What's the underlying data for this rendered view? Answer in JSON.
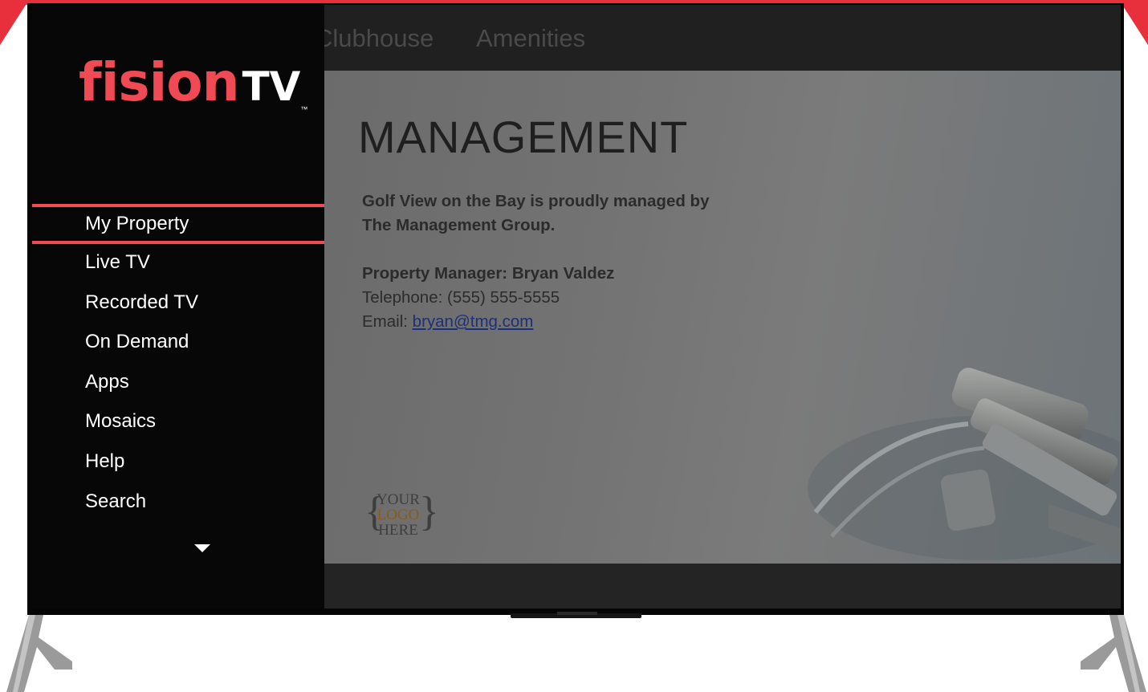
{
  "top_nav": {
    "tabs": [
      "Clubhouse",
      "Amenities"
    ]
  },
  "brand": {
    "logo_text_main": "fision",
    "logo_text_tv": "TV",
    "trademark": "™"
  },
  "side_menu": {
    "items": [
      {
        "label": "My Property",
        "active": true
      },
      {
        "label": "Live TV",
        "active": false
      },
      {
        "label": "Recorded TV",
        "active": false
      },
      {
        "label": "On Demand",
        "active": false
      },
      {
        "label": "Apps",
        "active": false
      },
      {
        "label": "Mosaics",
        "active": false
      },
      {
        "label": "Help",
        "active": false
      },
      {
        "label": "Search",
        "active": false
      }
    ],
    "more_icon": "chevron-down-icon"
  },
  "content": {
    "title": "MANAGEMENT",
    "intro_line1": "Golf View on the Bay is proudly managed by",
    "intro_line2": "The Management Group.",
    "manager_label": "Property Manager: Bryan Valdez",
    "telephone": "Telephone: (555) 555-5555",
    "email_label": "Email:",
    "email": "bryan@tmg.com",
    "logo_placeholder": {
      "line1": "YOUR",
      "line2": "LOGO",
      "line3": "HERE"
    }
  },
  "colors": {
    "accent": "#f04a55",
    "frame_red": "#e8303d",
    "menu_bg": "#070707",
    "link": "#1d2f78"
  }
}
